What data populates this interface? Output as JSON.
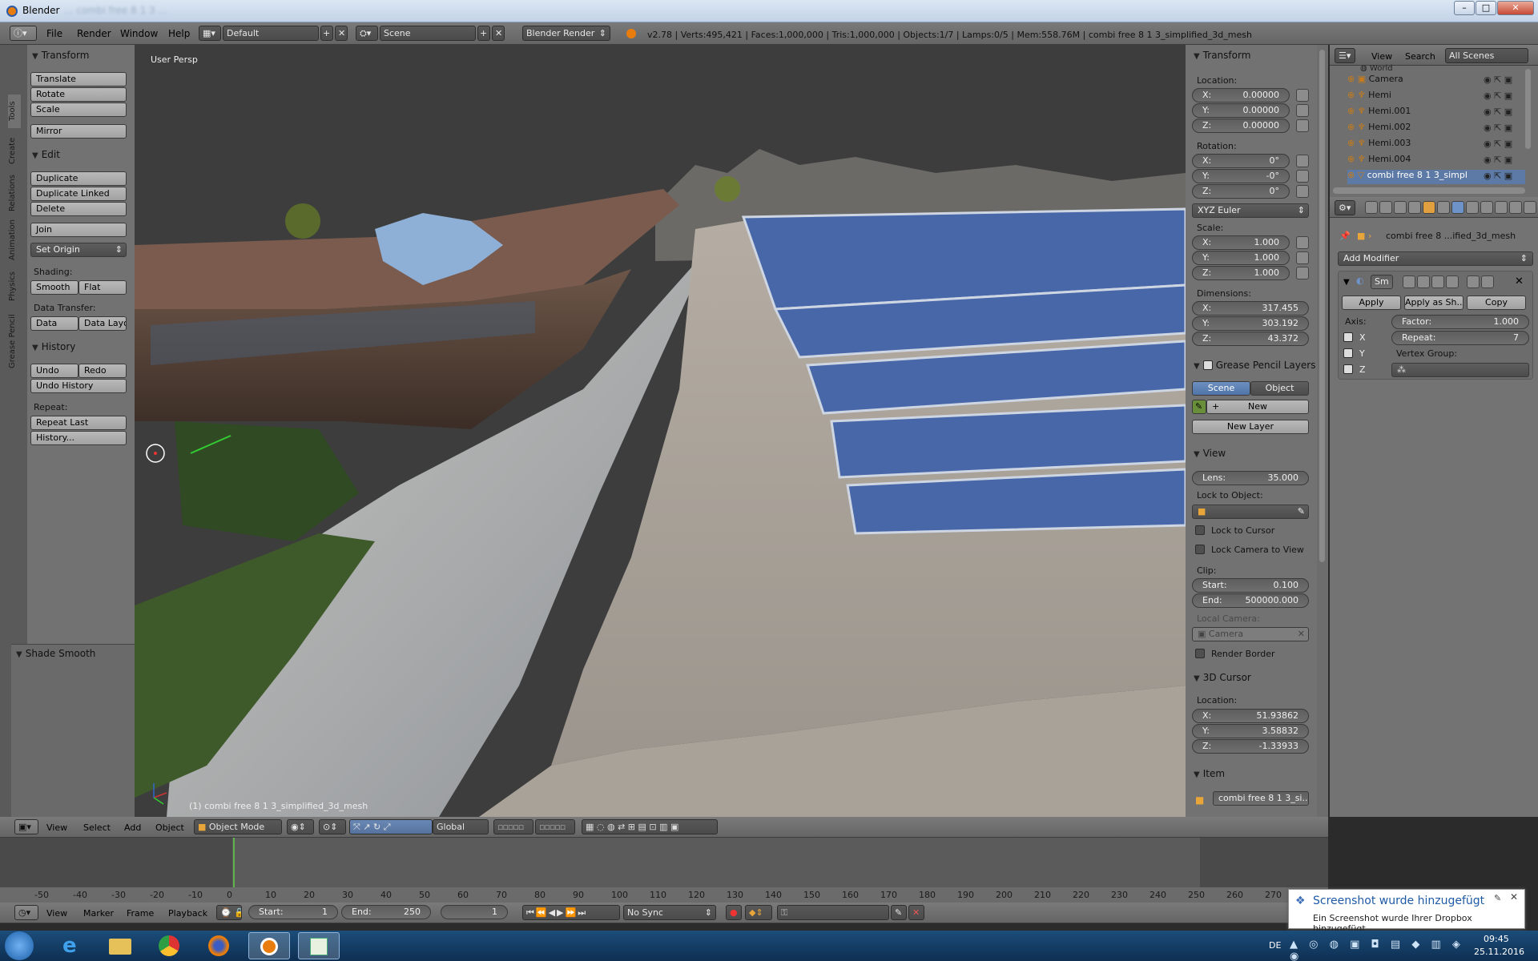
{
  "window": {
    "title": "Blender",
    "blurred_title": "... combi free 8 1 3 ..."
  },
  "menu": {
    "file": "File",
    "render": "Render",
    "window": "Window",
    "help": "Help"
  },
  "header": {
    "layout": "Default",
    "scene": "Scene",
    "engine": "Blender Render",
    "stats": "v2.78 | Verts:495,421 | Faces:1,000,000 | Tris:1,000,000 | Objects:1/7 | Lamps:0/5 | Mem:558.76M | combi free 8 1 3_simplified_3d_mesh"
  },
  "vtabs": [
    "Tools",
    "Create",
    "Relations",
    "Animation",
    "Physics",
    "Grease Pencil"
  ],
  "tools": {
    "transform_title": "Transform",
    "translate": "Translate",
    "rotate": "Rotate",
    "scale": "Scale",
    "mirror": "Mirror",
    "edit_title": "Edit",
    "duplicate": "Duplicate",
    "duplicate_linked": "Duplicate Linked",
    "delete": "Delete",
    "join": "Join",
    "set_origin": "Set Origin",
    "shading_label": "Shading:",
    "smooth": "Smooth",
    "flat": "Flat",
    "data_transfer_label": "Data Transfer:",
    "data": "Data",
    "data_layo": "Data Layo",
    "history_title": "History",
    "undo": "Undo",
    "redo": "Redo",
    "undo_history": "Undo History",
    "repeat_label": "Repeat:",
    "repeat_last": "Repeat Last",
    "history": "History...",
    "operator_title": "Shade Smooth"
  },
  "viewport": {
    "view_name": "User Persp",
    "object_label": "(1) combi free 8 1 3_simplified_3d_mesh"
  },
  "nprop": {
    "transform_title": "Transform",
    "location_label": "Location:",
    "loc": [
      {
        "k": "X:",
        "v": "0.00000"
      },
      {
        "k": "Y:",
        "v": "0.00000"
      },
      {
        "k": "Z:",
        "v": "0.00000"
      }
    ],
    "rotation_label": "Rotation:",
    "rot": [
      {
        "k": "X:",
        "v": "0°"
      },
      {
        "k": "Y:",
        "v": "-0°"
      },
      {
        "k": "Z:",
        "v": "0°"
      }
    ],
    "rotation_mode": "XYZ Euler",
    "scale_label": "Scale:",
    "scl": [
      {
        "k": "X:",
        "v": "1.000"
      },
      {
        "k": "Y:",
        "v": "1.000"
      },
      {
        "k": "Z:",
        "v": "1.000"
      }
    ],
    "dimensions_label": "Dimensions:",
    "dim": [
      {
        "k": "X:",
        "v": "317.455"
      },
      {
        "k": "Y:",
        "v": "303.192"
      },
      {
        "k": "Z:",
        "v": "43.372"
      }
    ],
    "gp_title": "Grease Pencil Layers",
    "gp_scene": "Scene",
    "gp_object": "Object",
    "gp_new": "New",
    "gp_new_layer": "New Layer",
    "view_title": "View",
    "lens_k": "Lens:",
    "lens_v": "35.000",
    "lock_obj_label": "Lock to Object:",
    "lock_cursor": "Lock to Cursor",
    "lock_camera": "Lock Camera to View",
    "clip_label": "Clip:",
    "clip_start_k": "Start:",
    "clip_start_v": "0.100",
    "clip_end_k": "End:",
    "clip_end_v": "500000.000",
    "local_camera_label": "Local Camera:",
    "local_camera": "Camera",
    "render_border": "Render Border",
    "cursor_title": "3D Cursor",
    "cursor_location_label": "Location:",
    "cur": [
      {
        "k": "X:",
        "v": "51.93862"
      },
      {
        "k": "Y:",
        "v": "3.58832"
      },
      {
        "k": "Z:",
        "v": "-1.33933"
      }
    ],
    "item_title": "Item",
    "item_name": "combi free 8 1 3_si..."
  },
  "outliner": {
    "view": "View",
    "search": "Search",
    "all_scenes": "All Scenes",
    "world_partial": "World",
    "items": [
      "Camera",
      "Hemi",
      "Hemi.001",
      "Hemi.002",
      "Hemi.003",
      "Hemi.004",
      "combi free 8 1 3_simpl"
    ]
  },
  "props": {
    "context_name": "combi free 8 ...ified_3d_mesh",
    "add_modifier": "Add Modifier",
    "mod_name": "Sm",
    "apply": "Apply",
    "apply_as": "Apply as Sh...",
    "copy": "Copy",
    "axis_label": "Axis:",
    "x": "X",
    "y": "Y",
    "z": "Z",
    "factor_k": "Factor:",
    "factor_v": "1.000",
    "repeat_k": "Repeat:",
    "repeat_v": "7",
    "vertex_group_label": "Vertex Group:"
  },
  "view3d_header": {
    "view": "View",
    "select": "Select",
    "add": "Add",
    "object": "Object",
    "mode": "Object Mode",
    "orientation": "Global"
  },
  "timeline": {
    "ticks": [
      "-50",
      "-40",
      "-30",
      "-20",
      "-10",
      "0",
      "10",
      "20",
      "30",
      "40",
      "50",
      "60",
      "70",
      "80",
      "90",
      "100",
      "110",
      "120",
      "130",
      "140",
      "150",
      "160",
      "170",
      "180",
      "190",
      "200",
      "210",
      "220",
      "230",
      "240",
      "250",
      "260",
      "270"
    ],
    "menu_view": "View",
    "menu_marker": "Marker",
    "menu_frame": "Frame",
    "menu_playback": "Playback",
    "start_k": "Start:",
    "start_v": "1",
    "end_k": "End:",
    "end_v": "250",
    "current": "1",
    "sync": "No Sync"
  },
  "notification": {
    "title": "Screenshot wurde hinzugefügt",
    "body": "Ein Screenshot wurde Ihrer Dropbox hinzugefügt."
  },
  "taskbar": {
    "lang": "DE",
    "time": "09:45",
    "date": "25.11.2016"
  }
}
